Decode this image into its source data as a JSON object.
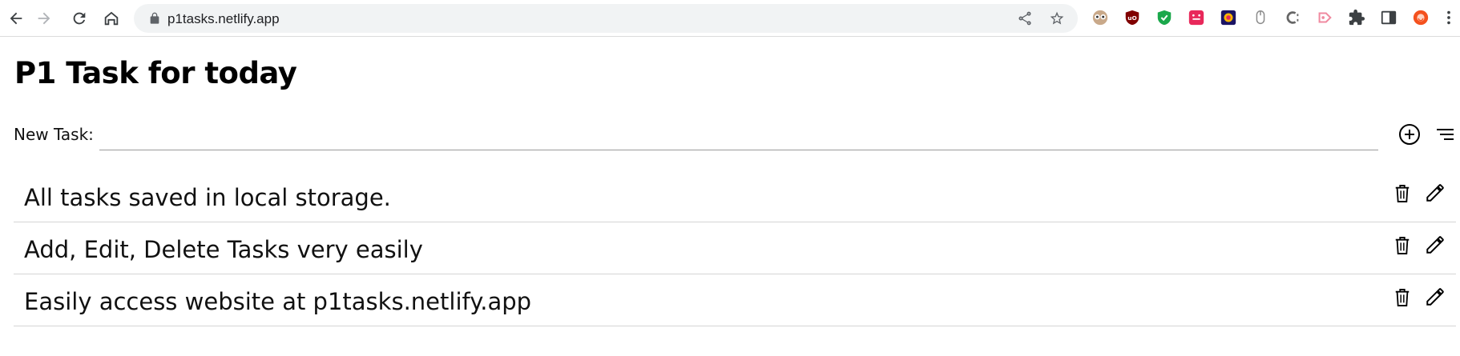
{
  "browser": {
    "url": "p1tasks.netlify.app",
    "extensions": [
      "owl-extension-icon",
      "ublock-icon",
      "shield-check-icon",
      "calendar-extension-icon",
      "color-picker-icon",
      "mouse-icon",
      "c-extension-icon",
      "cast-icon",
      "puzzle-icon",
      "side-panel-icon",
      "profile-avatar-icon",
      "more-menu-icon"
    ]
  },
  "app": {
    "title": "P1 Task for today",
    "new_task_label": "New Task:",
    "new_task_value": "",
    "tasks": [
      {
        "text": "All tasks saved in local storage."
      },
      {
        "text": "Add, Edit, Delete Tasks very easily"
      },
      {
        "text": "Easily access website at p1tasks.netlify.app"
      }
    ]
  },
  "colors": {
    "accent_red": "#d93025",
    "text": "#000000",
    "divider": "#d4d4d4"
  }
}
